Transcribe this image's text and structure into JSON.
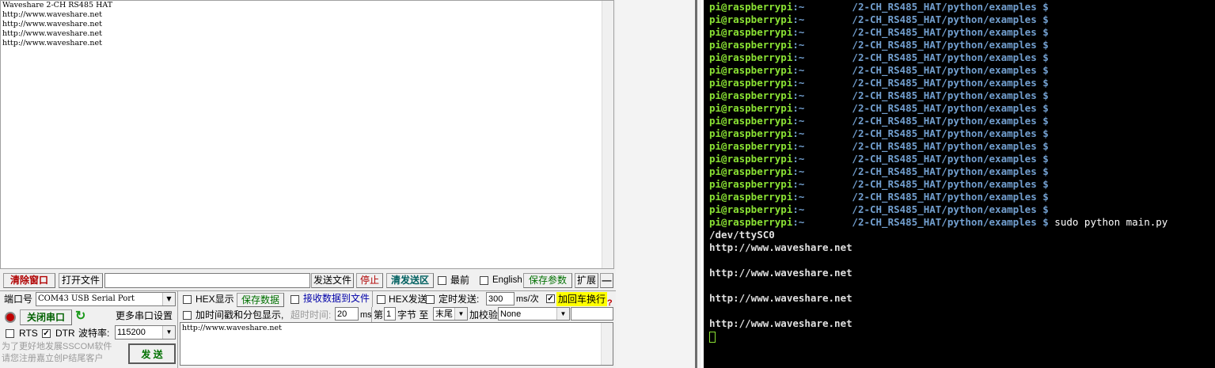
{
  "receive": {
    "lines": [
      "Waveshare 2-CH RS485 HAT",
      "http://www.waveshare.net",
      "http://www.waveshare.net",
      "http://www.waveshare.net",
      "http://www.waveshare.net"
    ]
  },
  "toolbar": {
    "clear_window": "清除窗口",
    "open_file": "打开文件",
    "file_path": "",
    "send_file": "发送文件",
    "stop": "停止",
    "clear_send": "清发送区",
    "topmost": "最前",
    "english": "English",
    "save_params": "保存参数",
    "expand": "扩展",
    "collapse": "—"
  },
  "port": {
    "label": "端口号",
    "value": "COM43 USB Serial Port",
    "close_button": "关闭串口",
    "more_settings": "更多串口设置",
    "rts": "RTS",
    "dtr": "DTR",
    "baud_label": "波特率:",
    "baud_value": "115200"
  },
  "options": {
    "hex_display": "HEX显示",
    "save_data": "保存数据",
    "recv_to_file": "接收数据到文件",
    "hex_send": "HEX发送",
    "timed_send": "定时发送:",
    "interval": "300",
    "interval_unit": "ms/次",
    "add_crlf": "加回车换行",
    "help_mark": "?",
    "timestamp": "加时间戳和分包显示,",
    "timeout_label": "超时时间:",
    "timeout_value": "20",
    "timeout_unit": "ms",
    "byte_prefix": "第",
    "byte_index": "1",
    "byte_suffix": "字节 至",
    "byte_end": "末尾",
    "checksum_label": "加校验",
    "checksum_value": "None"
  },
  "send": {
    "text": "http://www.waveshare.net",
    "button": "发 送"
  },
  "promo": {
    "line1": "为了更好地发展SSCOM软件",
    "line2": "请您注册嘉立创P结尾客户"
  },
  "terminal": {
    "user": "pi@raspberrypi",
    "home": ":~",
    "path": "/2-CH_RS485_HAT/python/examples",
    "prompt": "$",
    "repeat_lines": 18,
    "command": " sudo python main.py",
    "output": [
      "/dev/ttySC0",
      "http://www.waveshare.net",
      "",
      "http://www.waveshare.net",
      "",
      "http://www.waveshare.net",
      "",
      "http://www.waveshare.net"
    ]
  },
  "colors": {
    "terminal_bg": "#000000",
    "terminal_user": "#8ae234",
    "terminal_path": "#729fcf",
    "accent_red": "#b00000",
    "accent_green": "#007000",
    "highlight_yellow": "#ffff00"
  }
}
